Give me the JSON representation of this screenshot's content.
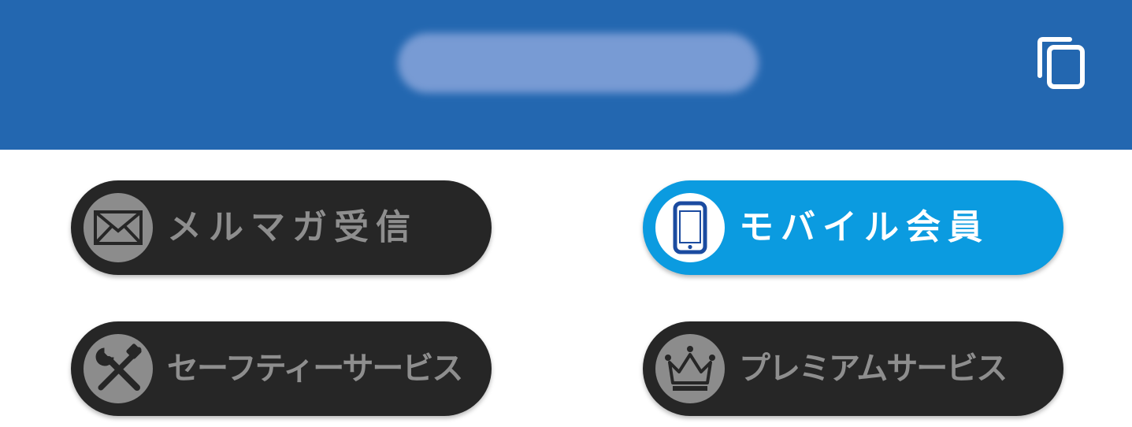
{
  "header": {
    "background_color": "#2367b0",
    "copy_icon": "copy-icon"
  },
  "buttons": {
    "mail_magazine": {
      "label": "メルマガ受信",
      "icon": "envelope-icon",
      "style": "dark"
    },
    "mobile_member": {
      "label": "モバイル会員",
      "icon": "smartphone-icon",
      "style": "active-blue"
    },
    "safety_service": {
      "label": "セーフティーサービス",
      "icon": "tools-icon",
      "style": "dark"
    },
    "premium_service": {
      "label": "プレミアムサービス",
      "icon": "crown-icon",
      "style": "dark"
    }
  },
  "colors": {
    "dark_pill": "#262626",
    "icon_circle": "#8c8c8c",
    "active_pill": "#0b9be0",
    "phone_icon": "#1b4ba0"
  }
}
